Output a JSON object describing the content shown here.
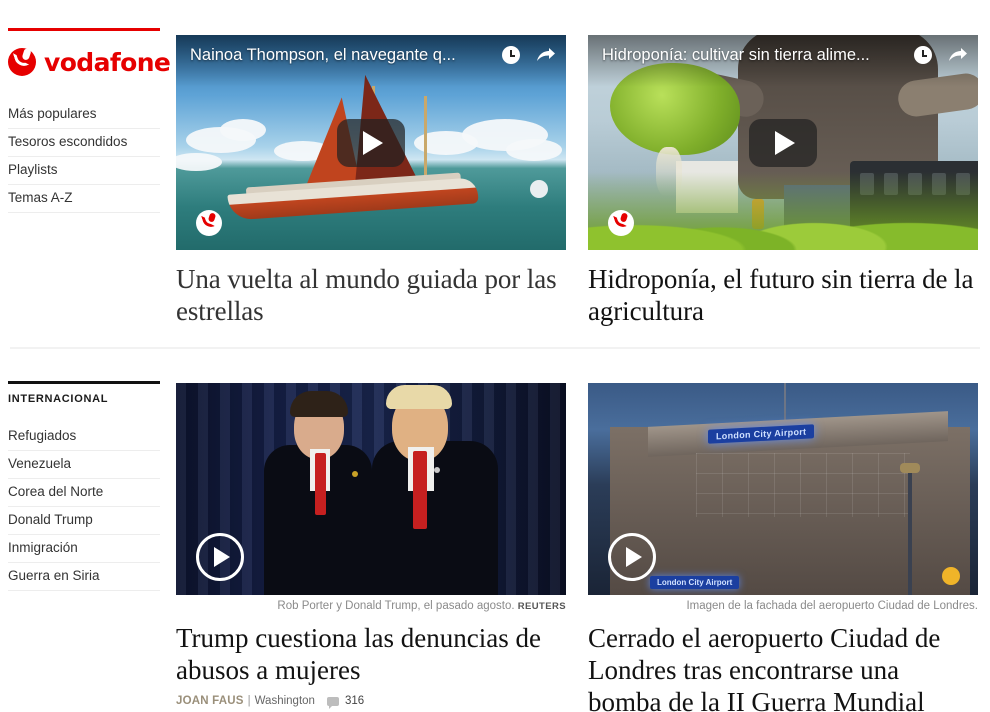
{
  "brand": {
    "logo_text": "vodafone",
    "accent_color": "#e60000"
  },
  "sidebar_primary": {
    "items": [
      {
        "label": "Más populares"
      },
      {
        "label": "Tesoros escondidos"
      },
      {
        "label": "Playlists"
      },
      {
        "label": "Temas A-Z"
      }
    ]
  },
  "sidebar_secondary": {
    "heading": "INTERNACIONAL",
    "items": [
      {
        "label": "Refugiados"
      },
      {
        "label": "Venezuela"
      },
      {
        "label": "Corea del Norte"
      },
      {
        "label": "Donald Trump"
      },
      {
        "label": "Inmigración"
      },
      {
        "label": "Guerra en Siria"
      }
    ]
  },
  "videos": [
    {
      "overlay_title": "Nainoa Thompson, el navegante q...",
      "headline": "Una vuelta al mundo guiada por las estrellas",
      "watch_later_icon": "clock-icon",
      "share_icon": "share-icon",
      "play_icon": "youtube-play-icon",
      "brand_badge_icon": "vodafone-badge-icon"
    },
    {
      "overlay_title": "Hidroponía: cultivar sin tierra alime...",
      "headline": "Hidroponía, el futuro sin tierra de la agricultura",
      "watch_later_icon": "clock-icon",
      "share_icon": "share-icon",
      "play_icon": "youtube-play-icon",
      "brand_badge_icon": "vodafone-badge-icon"
    }
  ],
  "news": [
    {
      "caption": "Rob Porter y Donald Trump, el pasado agosto.",
      "agency": "REUTERS",
      "headline": "Trump cuestiona las denuncias de abusos a mujeres",
      "author": "JOAN FAUS",
      "separator": "|",
      "place": "Washington",
      "comments": "316",
      "play_icon": "play-circle-icon",
      "comment_icon": "comment-bubble-icon"
    },
    {
      "caption": "Imagen de la fachada del aeropuerto Ciudad de Londres.",
      "agency": "",
      "headline": "Cerrado el aeropuerto Ciudad de Londres tras encontrarse una bomba de la II Guerra Mundial",
      "author": "",
      "separator": "",
      "place": "",
      "comments": "",
      "play_icon": "play-circle-icon",
      "comment_icon": ""
    }
  ],
  "scene_text": {
    "airport_sign": "London City Airport",
    "airport_sign_lower": "London City Airport"
  }
}
